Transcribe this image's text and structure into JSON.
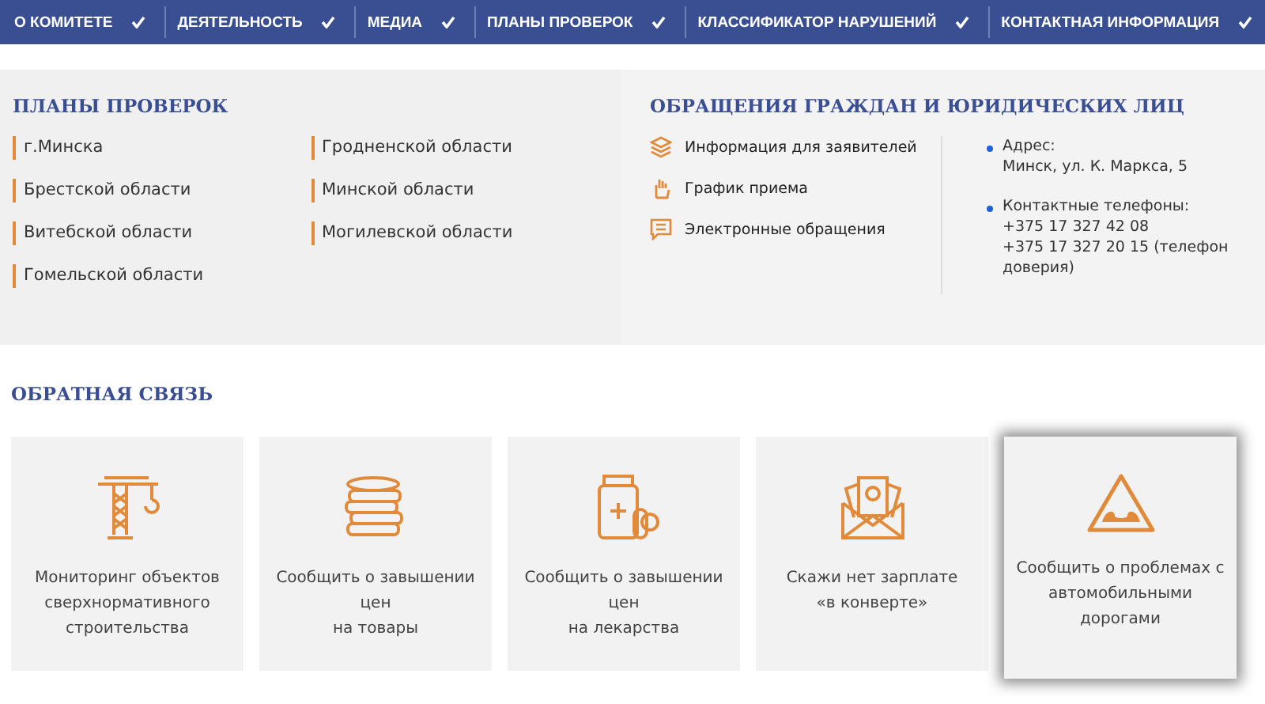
{
  "nav": [
    {
      "label": "О КОМИТЕТЕ"
    },
    {
      "label": "ДЕЯТЕЛЬНОСТЬ"
    },
    {
      "label": "МЕДИА"
    },
    {
      "label": "ПЛАНЫ ПРОВЕРОК"
    },
    {
      "label": "КЛАССИФИКАТОР НАРУШЕНИЙ"
    },
    {
      "label": "КОНТАКТНАЯ ИНФОРМАЦИЯ"
    }
  ],
  "plans": {
    "title": "ПЛАНЫ ПРОВЕРОК",
    "columns": [
      [
        "г.Минска",
        "Брестской области",
        "Витебской области",
        "Гомельской области"
      ],
      [
        "Гродненской области",
        "Минской области",
        "Могилевской области"
      ]
    ]
  },
  "appeals": {
    "title": "ОБРАЩЕНИЯ ГРАЖДАН И ЮРИДИЧЕСКИХ ЛИЦ",
    "links": [
      {
        "kind": "layers",
        "label": "Информация для заявителей"
      },
      {
        "kind": "hand",
        "label": "График приема"
      },
      {
        "kind": "chat",
        "label": "Электронные обращения"
      }
    ],
    "contacts": [
      {
        "label": "Адрес:",
        "lines": [
          "Минск, ул. К. Маркса, 5"
        ]
      },
      {
        "label": "Контактные телефоны:",
        "lines": [
          "+375 17 327 42 08",
          "+375 17 327 20 15 (телефон доверия)"
        ]
      }
    ]
  },
  "feedback": {
    "title": "ОБРАТНАЯ СВЯЗЬ",
    "cards": [
      {
        "kind": "crane",
        "text": "Мониторинг объектов\nсверхнормативного\nстроительства",
        "highlighted": false
      },
      {
        "kind": "coins",
        "text": "Сообщить о завышении\nцен\nна товары",
        "highlighted": false
      },
      {
        "kind": "medicine",
        "text": "Сообщить о завышении\nцен\nна лекарства",
        "highlighted": false
      },
      {
        "kind": "envelope",
        "text": "Скажи нет зарплате\n«в конверте»",
        "highlighted": false
      },
      {
        "kind": "road",
        "text": "Сообщить о проблемах с\nавтомобильными\nдорогами",
        "highlighted": true
      }
    ]
  }
}
